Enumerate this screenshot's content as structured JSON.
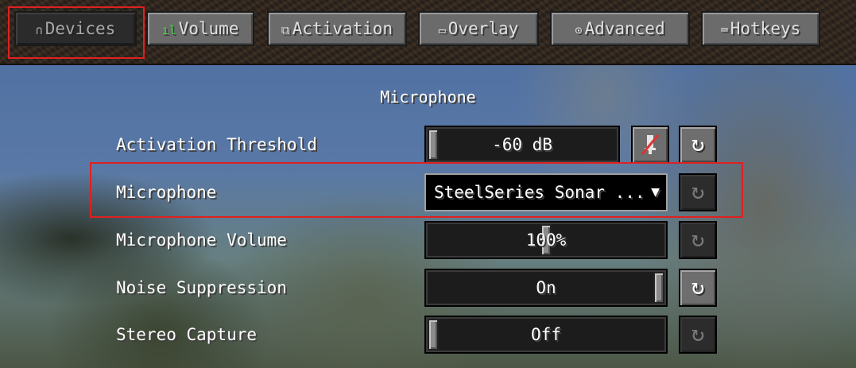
{
  "tabs": [
    {
      "label": "Devices",
      "icon": "headphones-icon",
      "glyph": "∩",
      "selected": true
    },
    {
      "label": "Volume",
      "icon": "volume-bars-icon",
      "glyph": "ıl",
      "selected": false
    },
    {
      "label": "Activation",
      "icon": "activation-icon",
      "glyph": "⧉",
      "selected": false
    },
    {
      "label": "Overlay",
      "icon": "monitor-icon",
      "glyph": "▭",
      "selected": false
    },
    {
      "label": "Advanced",
      "icon": "gear-icon",
      "glyph": "⊙",
      "selected": false
    },
    {
      "label": "Hotkeys",
      "icon": "keyboard-icon",
      "glyph": "⌨",
      "selected": false
    }
  ],
  "section_title": "Microphone",
  "settings": {
    "activation_threshold": {
      "label": "Activation Threshold",
      "value": "-60 dB",
      "slider_fraction": 0.0
    },
    "microphone": {
      "label": "Microphone",
      "value": "SteelSeries Sonar ..."
    },
    "microphone_volume": {
      "label": "Microphone Volume",
      "value": "100%",
      "slider_fraction": 0.5
    },
    "noise_suppression": {
      "label": "Noise Suppression",
      "value": "On",
      "slider_fraction": 1.0
    },
    "stereo_capture": {
      "label": "Stereo Capture",
      "value": "Off",
      "slider_fraction": 0.0
    }
  },
  "icons": {
    "reset": "↻",
    "dropdown_arrow": "▼"
  },
  "colors": {
    "highlight": "#e02020",
    "volume_icon": "#3ed43e"
  }
}
